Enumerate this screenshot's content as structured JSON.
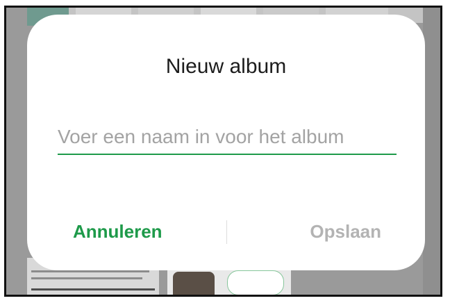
{
  "dialog": {
    "title": "Nieuw album",
    "input": {
      "value": "",
      "placeholder": "Voer een naam in voor het album"
    },
    "cancel_label": "Annuleren",
    "save_label": "Opslaan"
  },
  "colors": {
    "accent": "#1e9a4a",
    "disabled_text": "#b3b3b3",
    "dialog_background": "#ffffff",
    "scrim": "#9a9a9a"
  }
}
